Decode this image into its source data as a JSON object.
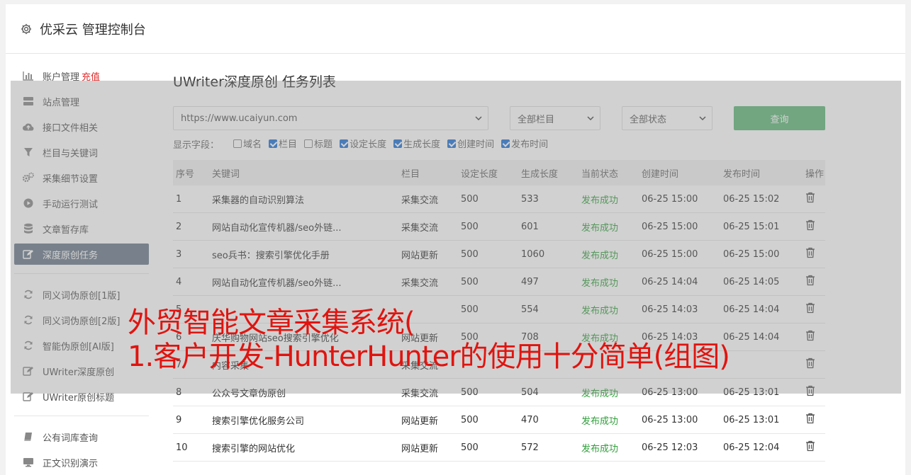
{
  "app": {
    "title": "优采云 管理控制台"
  },
  "sidebar": {
    "items": [
      {
        "label": "账户管理",
        "extra": "充值",
        "icon": "bar-chart-icon"
      },
      {
        "label": "站点管理",
        "icon": "server-icon"
      },
      {
        "label": "接口文件相关",
        "icon": "cloud-upload-icon"
      },
      {
        "label": "栏目与关键词",
        "icon": "filter-icon"
      },
      {
        "label": "采集细节设置",
        "icon": "cogs-icon"
      },
      {
        "label": "手动运行测试",
        "icon": "play-circle-icon"
      },
      {
        "label": "文章暂存库",
        "icon": "database-icon"
      },
      {
        "label": "深度原创任务",
        "icon": "edit-icon",
        "active": true
      }
    ],
    "items2": [
      {
        "label": "同义词伪原创[1版]",
        "icon": "refresh-icon"
      },
      {
        "label": "同义词伪原创[2版]",
        "icon": "refresh-icon"
      },
      {
        "label": "智能伪原创[AI版]",
        "icon": "refresh-icon"
      },
      {
        "label": "UWriter深度原创",
        "icon": "edit-icon"
      },
      {
        "label": "UWriter原创标题",
        "icon": "edit-icon"
      }
    ],
    "items3": [
      {
        "label": "公有词库查询",
        "icon": "book-icon"
      },
      {
        "label": "正文识别演示",
        "icon": "monitor-icon"
      }
    ]
  },
  "main": {
    "title": "UWriter深度原创 任务列表",
    "site_select": "https://www.ucaiyun.com",
    "column_select": "全部栏目",
    "status_select": "全部状态",
    "query_label": "查询",
    "fields_label": "显示字段：",
    "fields": [
      {
        "label": "域名",
        "checked": false
      },
      {
        "label": "栏目",
        "checked": true
      },
      {
        "label": "标题",
        "checked": false
      },
      {
        "label": "设定长度",
        "checked": true
      },
      {
        "label": "生成长度",
        "checked": true
      },
      {
        "label": "创建时间",
        "checked": true
      },
      {
        "label": "发布时间",
        "checked": true
      }
    ],
    "table": {
      "headers": [
        "序号",
        "关键词",
        "栏目",
        "设定长度",
        "生成长度",
        "当前状态",
        "创建时间",
        "发布时间",
        "操作"
      ],
      "rows": [
        [
          "1",
          "采集器的自动识别算法",
          "采集交流",
          "500",
          "533",
          "发布成功",
          "06-25 15:00",
          "06-25 15:02"
        ],
        [
          "2",
          "网站自动化宣传机器/seo外链...",
          "采集交流",
          "500",
          "601",
          "发布成功",
          "06-25 15:00",
          "06-25 15:01"
        ],
        [
          "3",
          "seo兵书：搜索引擎优化手册",
          "网站更新",
          "500",
          "1060",
          "发布成功",
          "06-25 15:00",
          "06-25 15:00"
        ],
        [
          "4",
          "网站自动化宣传机器/seo外链...",
          "采集交流",
          "500",
          "497",
          "发布成功",
          "06-25 14:04",
          "06-25 14:05"
        ],
        [
          "5",
          "",
          "",
          "500",
          "554",
          "发布成功",
          "06-25 14:03",
          "06-25 14:04"
        ],
        [
          "6",
          "庆华购物网站seo搜索引擎优化",
          "网站更新",
          "500",
          "708",
          "发布成功",
          "06-25 14:03",
          "06-25 14:04"
        ],
        [
          "7",
          "内容采集",
          "采集交流",
          "",
          "",
          "",
          "",
          ""
        ],
        [
          "8",
          "公众号文章伪原创",
          "采集交流",
          "500",
          "504",
          "发布成功",
          "06-25 13:00",
          "06-25 13:01"
        ],
        [
          "9",
          "搜索引擎优化服务公司",
          "网站更新",
          "500",
          "470",
          "发布成功",
          "06-25 13:00",
          "06-25 13:01"
        ],
        [
          "10",
          "搜索引擎的网站优化",
          "网站更新",
          "500",
          "572",
          "发布成功",
          "06-25 12:03",
          "06-25 12:04"
        ]
      ]
    }
  },
  "watermark": {
    "line1": "外贸智能文章采集系统(",
    "line2": "1.客户开发-HunterHunter的使用十分简单(组图)"
  },
  "colors": {
    "accent": "#5fb878",
    "active_nav": "#6c7a8a",
    "success": "#2f9e3a",
    "watermark": "#e0140f",
    "recharge": "#e02a2a"
  }
}
